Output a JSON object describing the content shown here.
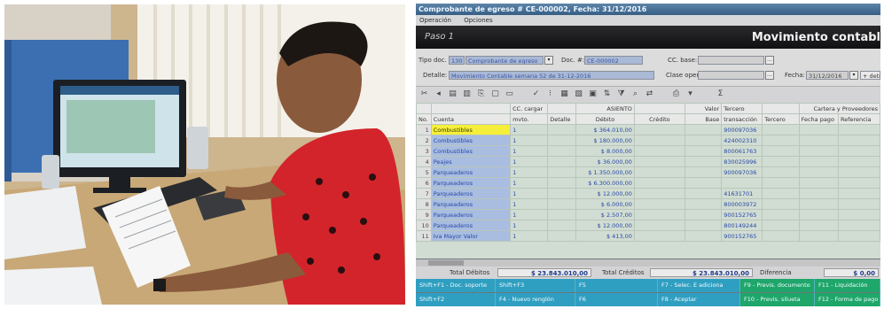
{
  "window": {
    "title": "Comprobante de egreso # CE-000002, Fecha: 31/12/2016",
    "menu": [
      "Operación",
      "Opciones"
    ]
  },
  "header": {
    "step": "Paso 1",
    "title": "Movimiento contabl"
  },
  "form": {
    "tipo_doc_label": "Tipo doc.",
    "tipo_doc_code": "130",
    "tipo_doc_name": "Comprobante de egreso",
    "doc_label": "Doc. #:",
    "doc_value": "CE-000002",
    "cc_base_label": "CC. base:",
    "detalle_label": "Detalle:",
    "detalle_value": "Movimiento Contable semana 52 de 31-12-2016",
    "clase_oper_label": "Clase oper.",
    "fecha_label": "Fecha:",
    "fecha_value": "31/12/2016",
    "extra_button": "+ detr"
  },
  "grid": {
    "group_headers": {
      "cc": "CC. cargar",
      "asiento": "ASIENTO",
      "valor": "Valor",
      "tercero": "Tercero",
      "cartera": "Cartera y Proveedores"
    },
    "columns": [
      "No.",
      "Cuenta",
      "mvto.",
      "Detalle",
      "Débito",
      "Crédito",
      "Base",
      "transacción",
      "Tercero",
      "Fecha pago",
      "Referencia"
    ],
    "rows": [
      {
        "no": "1",
        "cuenta": "Combustibles",
        "cc": "1",
        "debito": "$ 364.010,00",
        "tercero": "900097036"
      },
      {
        "no": "2",
        "cuenta": "Combustibles",
        "cc": "1",
        "debito": "$ 180.000,00",
        "tercero": "424002310"
      },
      {
        "no": "3",
        "cuenta": "Combustibles",
        "cc": "1",
        "debito": "$ 8.000,00",
        "tercero": "800061763"
      },
      {
        "no": "4",
        "cuenta": "Peajes",
        "cc": "1",
        "debito": "$ 36.000,00",
        "tercero": "830025996"
      },
      {
        "no": "5",
        "cuenta": "Parqueaderos",
        "cc": "1",
        "debito": "$ 1.350.000,00",
        "tercero": "900097036"
      },
      {
        "no": "6",
        "cuenta": "Parqueaderos",
        "cc": "1",
        "debito": "$ 6.300.000,00",
        "tercero": ""
      },
      {
        "no": "7",
        "cuenta": "Parqueaderos",
        "cc": "1",
        "debito": "$ 12.000,00",
        "tercero": "41631701"
      },
      {
        "no": "8",
        "cuenta": "Parqueaderos",
        "cc": "1",
        "debito": "$ 6.000,00",
        "tercero": "800003972"
      },
      {
        "no": "9",
        "cuenta": "Parqueaderos",
        "cc": "1",
        "debito": "$ 2.507,00",
        "tercero": "900152765"
      },
      {
        "no": "10",
        "cuenta": "Parqueaderos",
        "cc": "1",
        "debito": "$ 12.000,00",
        "tercero": "800149244"
      },
      {
        "no": "11",
        "cuenta": "Iva Mayor Valor",
        "cc": "1",
        "debito": "$ 413,00",
        "tercero": "900152765"
      }
    ]
  },
  "totals": {
    "debitos_label": "Total Débitos",
    "debitos_value": "$ 23.843.010,00",
    "creditos_label": "Total Créditos",
    "creditos_value": "$ 23.843.010,00",
    "diferencia_label": "Diferencia",
    "diferencia_value": "$ 0,00"
  },
  "function_keys": [
    {
      "label": "Shift+F1 - Doc. soporte",
      "color": "cyan"
    },
    {
      "label": "Shift+F3",
      "color": "cyan"
    },
    {
      "label": "F5",
      "color": "cyan"
    },
    {
      "label": "F7 - Selec. E adiciona",
      "color": "cyan"
    },
    {
      "label": "F9 - Previs. documento",
      "color": "green"
    },
    {
      "label": "F11 - Liquidación",
      "color": "green"
    },
    {
      "label": "Shift+F2",
      "color": "cyan"
    },
    {
      "label": "F4 - Nuevo renglón",
      "color": "cyan"
    },
    {
      "label": "F6",
      "color": "cyan"
    },
    {
      "label": "F8 - Aceptar",
      "color": "cyan"
    },
    {
      "label": "F10 - Previs. silueta",
      "color": "green"
    },
    {
      "label": "F12 - Forma de pago",
      "color": "green"
    }
  ],
  "colors": {
    "title_bar": "#365f86",
    "header_black": "#111114",
    "selected_cell": "#f5ef3c",
    "fkey_cyan": "#2f9fc1",
    "fkey_green": "#1fa66a",
    "shirt_red": "#d3242b"
  }
}
